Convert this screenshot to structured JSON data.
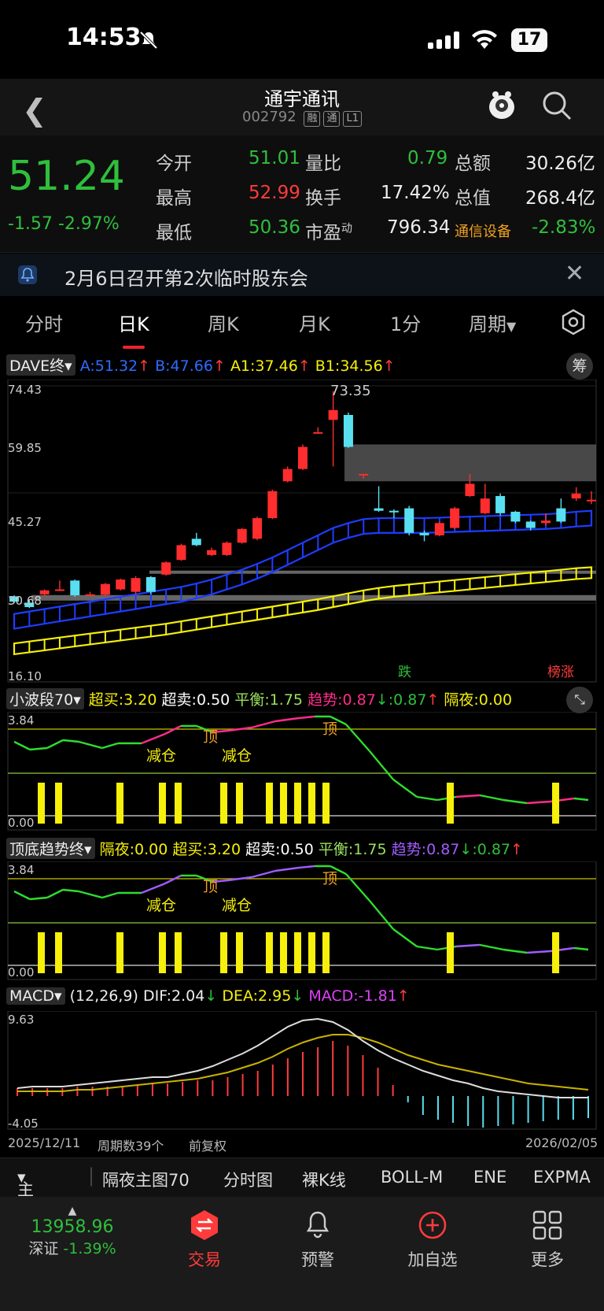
{
  "status": {
    "time": "14:53",
    "battery": "17"
  },
  "nav": {
    "title": "通宇通讯",
    "code": "002792",
    "tags": [
      "融",
      "通",
      "L1"
    ]
  },
  "quote": {
    "price": "51.24",
    "change": "-1.57",
    "change_pct": "-2.97%",
    "fields": [
      {
        "label": "今开",
        "value": "51.01",
        "color": "green"
      },
      {
        "label": "量比",
        "value": "0.79",
        "color": "green"
      },
      {
        "label": "总额",
        "value": "30.26亿",
        "color": "white"
      },
      {
        "label": "最高",
        "value": "52.99",
        "color": "red"
      },
      {
        "label": "换手",
        "value": "17.42%",
        "color": "white"
      },
      {
        "label": "总值",
        "value": "268.4亿",
        "color": "white"
      },
      {
        "label": "最低",
        "value": "50.36",
        "color": "green"
      },
      {
        "label": "市盈",
        "value": "796.34",
        "color": "white"
      },
      {
        "label": "通信设备",
        "value": "-2.83%",
        "color": "green"
      }
    ],
    "pe_superscript": "动"
  },
  "notice": {
    "text": "2月6日召开第2次临时股东会"
  },
  "tabs": [
    "分时",
    "日K",
    "周K",
    "月K",
    "1分",
    "周期"
  ],
  "main_chart": {
    "indicator": "DAVE终",
    "a": "A:51.32",
    "b": "B:47.66",
    "a1": "A1:37.46",
    "b1": "B1:34.56",
    "chip": "筹",
    "yticks": [
      "74.43",
      "59.85",
      "45.27",
      "30.68",
      "16.10"
    ],
    "high_label": "73.35",
    "marker_die": "跌",
    "marker_bang": "榜涨"
  },
  "ind1": {
    "name": "小波段70",
    "chaomai": "超买:3.20",
    "chaomai2": "超卖:0.50",
    "pingheng": "平衡:1.75",
    "qushi": "趋势:0.87",
    "qushi2": ":0.87",
    "geye": "隔夜:0.00",
    "ytop": "3.84",
    "ybot": "0.00",
    "labels": [
      "顶",
      "顶",
      "减仓",
      "减仓"
    ]
  },
  "ind2": {
    "name": "顶底趋势终",
    "geye": "隔夜:0.00",
    "chaomai": "超买:3.20",
    "chaomai2": "超卖:0.50",
    "pingheng": "平衡:1.75",
    "qushi": "趋势:0.87",
    "qushi2": ":0.87",
    "ytop": "3.84",
    "ybot": "0.00",
    "labels": [
      "顶",
      "顶",
      "减仓",
      "减仓"
    ]
  },
  "macd": {
    "name": "MACD",
    "params": "(12,26,9)",
    "dif": "DIF:2.04",
    "dea": "DEA:2.95",
    "macd": "MACD:-1.81",
    "ytop": "9.63",
    "ybot": "-4.05"
  },
  "footer": {
    "start": "2025/12/11",
    "count": "周期数39个",
    "adj": "前复权",
    "end": "2026/02/05"
  },
  "btabs": [
    "主图",
    "隔夜主图70",
    "分时图",
    "裸K线",
    "BOLL-M",
    "ENE",
    "EXPMA"
  ],
  "bottom": {
    "index_value": "13958.96",
    "index_name": "深证",
    "index_pct": "-1.39%",
    "items": [
      "交易",
      "预警",
      "加自选",
      "更多"
    ]
  },
  "chart_data": {
    "type": "candlestick",
    "title": "",
    "ylim": [
      16.1,
      74.43
    ],
    "x_range": [
      "2025/12/11",
      "2026/02/05"
    ],
    "candles": [
      {
        "o": 31.6,
        "c": 30.5,
        "h": 31.8,
        "l": 30.2
      },
      {
        "o": 30.3,
        "c": 29.4,
        "h": 30.8,
        "l": 29.2
      },
      {
        "o": 32.0,
        "c": 32.8,
        "h": 33.0,
        "l": 31.6
      },
      {
        "o": 33.0,
        "c": 33.0,
        "h": 34.8,
        "l": 33.0
      },
      {
        "o": 34.8,
        "c": 31.8,
        "h": 35.0,
        "l": 31.5
      },
      {
        "o": 31.8,
        "c": 32.0,
        "h": 32.5,
        "l": 31.7
      },
      {
        "o": 31.9,
        "c": 34.1,
        "h": 34.3,
        "l": 31.6
      },
      {
        "o": 33.0,
        "c": 35.0,
        "h": 35.2,
        "l": 32.8
      },
      {
        "o": 32.5,
        "c": 35.3,
        "h": 35.7,
        "l": 32.0
      },
      {
        "o": 35.5,
        "c": 32.5,
        "h": 35.7,
        "l": 32.0
      },
      {
        "o": 36.0,
        "c": 38.5,
        "h": 38.7,
        "l": 35.8
      },
      {
        "o": 39.0,
        "c": 42.0,
        "h": 42.3,
        "l": 38.8
      },
      {
        "o": 43.3,
        "c": 42.0,
        "h": 44.5,
        "l": 41.8
      },
      {
        "o": 40.0,
        "c": 41.0,
        "h": 41.5,
        "l": 39.8
      },
      {
        "o": 40.0,
        "c": 42.5,
        "h": 42.8,
        "l": 39.8
      },
      {
        "o": 42.5,
        "c": 45.3,
        "h": 45.5,
        "l": 42.3
      },
      {
        "o": 43.3,
        "c": 47.5,
        "h": 47.8,
        "l": 43.0
      },
      {
        "o": 47.5,
        "c": 53.0,
        "h": 53.3,
        "l": 47.3
      },
      {
        "o": 55.0,
        "c": 57.5,
        "h": 58.0,
        "l": 54.8
      },
      {
        "o": 57.5,
        "c": 62.0,
        "h": 62.5,
        "l": 57.3
      },
      {
        "o": 65.0,
        "c": 65.0,
        "h": 66.0,
        "l": 65.0
      },
      {
        "o": 67.5,
        "c": 69.5,
        "h": 73.35,
        "l": 58.0
      },
      {
        "o": 68.5,
        "c": 62.0,
        "h": 69.0,
        "l": 61.8
      },
      {
        "o": 56.5,
        "c": 56.5,
        "h": 56.5,
        "l": 55.5
      },
      {
        "o": 49.5,
        "c": 49.0,
        "h": 54.0,
        "l": 48.8
      },
      {
        "o": 49.0,
        "c": 48.8,
        "h": 49.3,
        "l": 47.5
      },
      {
        "o": 49.5,
        "c": 44.5,
        "h": 50.0,
        "l": 44.0
      },
      {
        "o": 44.5,
        "c": 44.0,
        "h": 45.0,
        "l": 42.8
      },
      {
        "o": 44.0,
        "c": 46.5,
        "h": 46.8,
        "l": 43.8
      },
      {
        "o": 45.5,
        "c": 49.5,
        "h": 49.8,
        "l": 45.3
      },
      {
        "o": 52.0,
        "c": 54.5,
        "h": 56.5,
        "l": 51.8
      },
      {
        "o": 48.5,
        "c": 51.5,
        "h": 54.5,
        "l": 48.3
      },
      {
        "o": 52.0,
        "c": 48.5,
        "h": 52.5,
        "l": 48.0
      },
      {
        "o": 48.8,
        "c": 46.8,
        "h": 49.0,
        "l": 46.5
      },
      {
        "o": 46.8,
        "c": 45.5,
        "h": 47.0,
        "l": 45.0
      },
      {
        "o": 46.5,
        "c": 47.0,
        "h": 48.5,
        "l": 46.0
      },
      {
        "o": 49.5,
        "c": 46.8,
        "h": 51.5,
        "l": 46.5
      },
      {
        "o": 51.5,
        "c": 52.5,
        "h": 53.8,
        "l": 51.0
      },
      {
        "o": 51.0,
        "c": 51.24,
        "h": 52.99,
        "l": 50.36
      }
    ],
    "dave_A_upper": [
      28.0,
      28.5,
      29.0,
      29.5,
      30.0,
      30.5,
      31.0,
      31.5,
      32.0,
      32.5,
      33.0,
      33.5,
      34.2,
      35.0,
      36.0,
      37.0,
      38.2,
      39.5,
      41.0,
      42.5,
      44.0,
      45.5,
      46.5,
      47.3,
      47.5,
      47.5,
      47.5,
      47.5,
      47.6,
      47.7,
      47.8,
      47.9,
      48.0,
      48.1,
      48.2,
      48.3,
      48.5,
      48.8,
      49.0
    ],
    "dave_B_upper": [
      22.0,
      22.4,
      22.8,
      23.2,
      23.6,
      24.0,
      24.4,
      24.8,
      25.2,
      25.6,
      26.0,
      26.5,
      27.0,
      27.5,
      28.0,
      28.5,
      29.0,
      29.5,
      30.0,
      30.5,
      31.0,
      31.6,
      32.2,
      32.8,
      33.3,
      33.7,
      34.0,
      34.3,
      34.6,
      34.9,
      35.2,
      35.5,
      35.8,
      36.1,
      36.4,
      36.7,
      37.0,
      37.3,
      37.5
    ]
  }
}
